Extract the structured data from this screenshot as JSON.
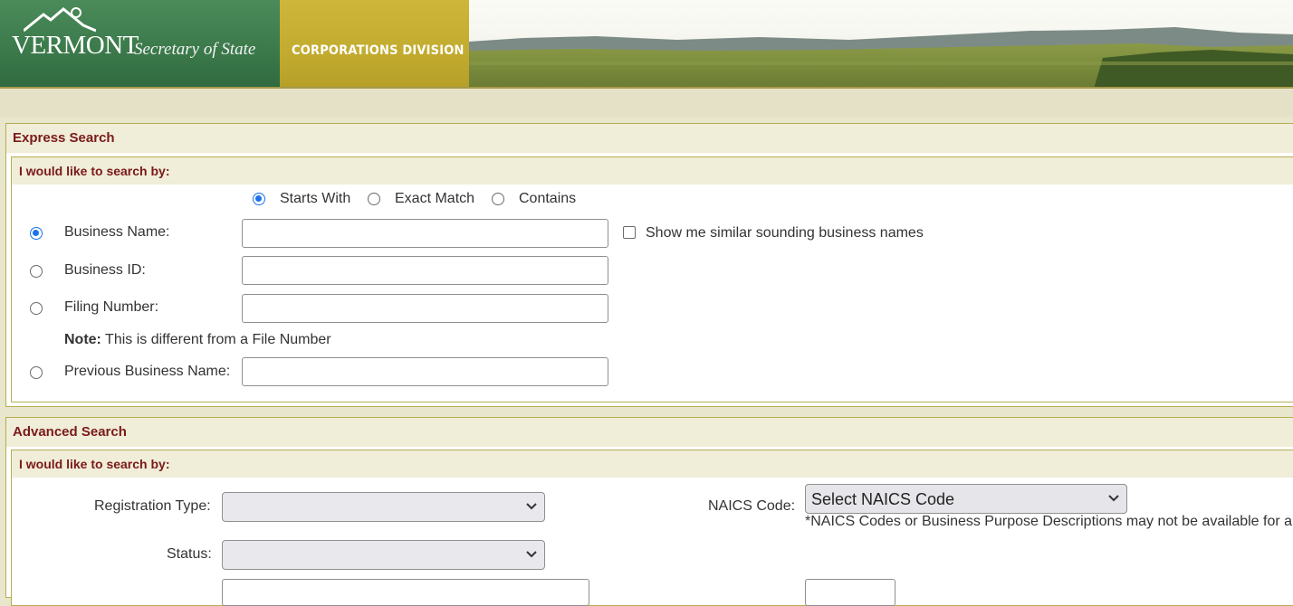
{
  "header": {
    "state_name": "VERMONT",
    "office": "Secretary of State",
    "division": "CORPORATIONS  DIVISION"
  },
  "express": {
    "title": "Express Search",
    "subtitle": "I would like to search by:",
    "match_options": [
      "Starts With",
      "Exact Match",
      "Contains"
    ],
    "selected_match": "Starts With",
    "fields": {
      "business_name": "Business Name:",
      "business_id": "Business ID:",
      "filing_number": "Filing Number:",
      "previous_name": "Previous Business Name:"
    },
    "selected_field": "Business Name:",
    "similar_label": "Show me similar sounding business names",
    "note_bold": "Note:",
    "note_text": " This is different from a File Number"
  },
  "advanced": {
    "title": "Advanced Search",
    "subtitle": "I would like to search by:",
    "registration_type_label": "Registration Type:",
    "registration_type_value": "",
    "status_label": "Status:",
    "status_value": "",
    "naics_label": "NAICS Code:",
    "naics_value": "Select NAICS Code",
    "naics_note": "*NAICS Codes or Business Purpose Descriptions may not be available for all businesses."
  },
  "colors": {
    "accent_red": "#7a1a1a",
    "panel_border": "#b7ad52",
    "radio_selected": "#1a73e8"
  }
}
